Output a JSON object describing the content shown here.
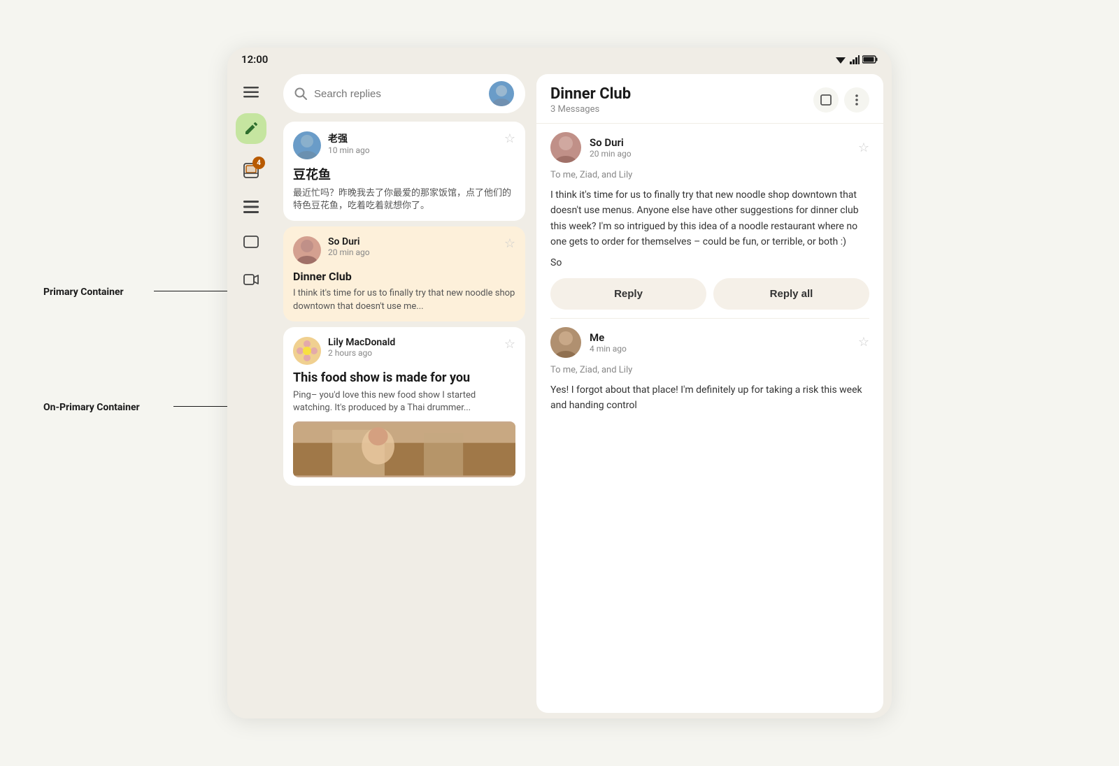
{
  "statusBar": {
    "time": "12:00",
    "wifiIcon": "▾",
    "signalIcon": "▲",
    "batteryIcon": "▮"
  },
  "sidebar": {
    "menuIcon": "☰",
    "composeIcon": "✏",
    "inboxIcon": "📷",
    "listIcon": "≡",
    "chatIcon": "☐",
    "videoIcon": "▷",
    "badge": "4"
  },
  "searchBar": {
    "placeholder": "Search replies"
  },
  "emails": [
    {
      "sender": "老强",
      "time": "10 min ago",
      "subject": "豆花鱼",
      "preview": "最近忙吗？昨晚我去了你最爱的那家饭馆，点了他们的特色豆花鱼，吃着吃着就想你了。",
      "selected": false
    },
    {
      "sender": "So Duri",
      "time": "20 min ago",
      "subject": "Dinner Club",
      "preview": "I think it's time for us to finally try that new noodle shop downtown that doesn't use me...",
      "selected": true
    },
    {
      "sender": "Lily MacDonald",
      "time": "2 hours ago",
      "subject": "This food show is made for you",
      "preview": "Ping– you'd love this new food show I started watching. It's produced by a Thai drummer...",
      "selected": false,
      "hasImage": true
    }
  ],
  "detail": {
    "title": "Dinner Club",
    "messageCount": "3 Messages",
    "messages": [
      {
        "sender": "So Duri",
        "time": "20 min ago",
        "recipients": "To me, Ziad, and Lily",
        "body": "I think it's time for us to finally try that new noodle shop downtown that doesn't use menus. Anyone else have other suggestions for dinner club this week? I'm so intrigued by this idea of a noodle restaurant where no one gets to order for themselves – could be fun, or terrible, or both :)",
        "signature": "So"
      },
      {
        "sender": "Me",
        "time": "4 min ago",
        "recipients": "To me, Ziad, and Lily",
        "body": "Yes! I forgot about that place! I'm definitely up for taking a risk this week and handing control"
      }
    ],
    "replyLabel": "Reply",
    "replyAllLabel": "Reply all"
  },
  "annotations": {
    "primaryContainer": "Primary Container",
    "onPrimaryContainer": "On-Primary Container"
  }
}
